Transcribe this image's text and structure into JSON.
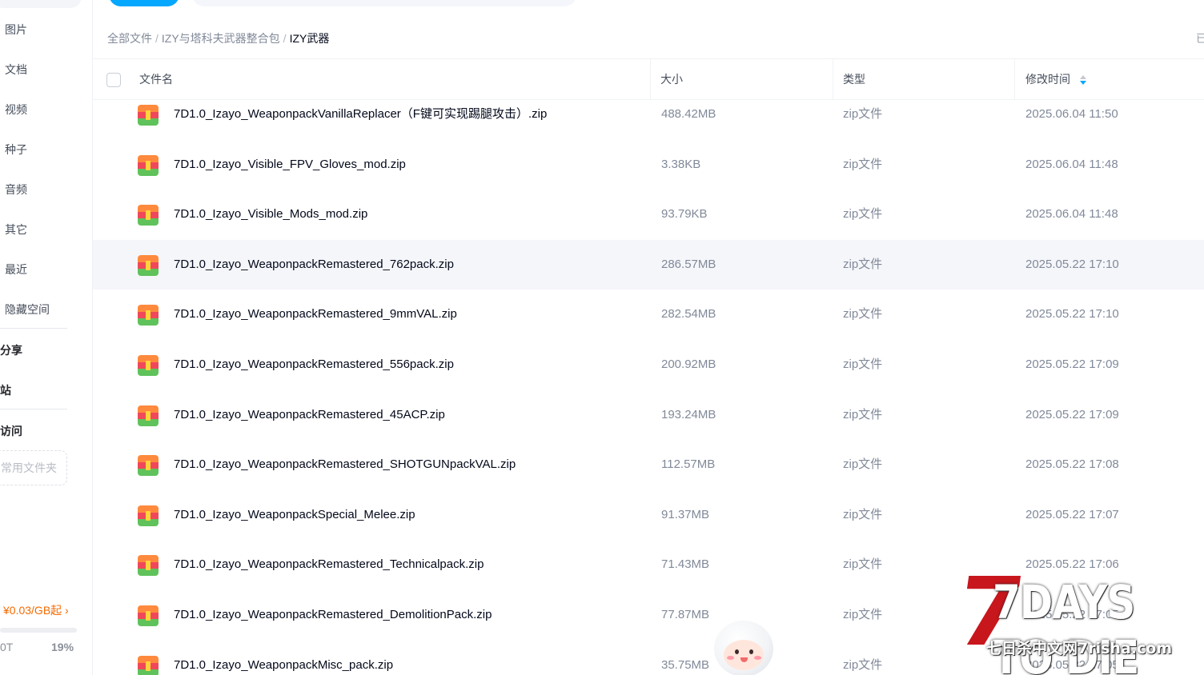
{
  "sidebar": {
    "categories": [
      "图片",
      "文档",
      "视频",
      "种子",
      "音频",
      "其它",
      "最近",
      "隐藏空间"
    ],
    "sections": [
      "分享",
      "站",
      "访问"
    ],
    "quick_folder_placeholder": "常用文件夹",
    "price": "¥0.03/GB起",
    "price_chevron": "›",
    "storage_left": "0T",
    "storage_percent": "19%",
    "storage_percent_value": 0.19
  },
  "breadcrumb": {
    "items": [
      "全部文件",
      "IZY与塔科夫武器整合包"
    ],
    "separator": "/",
    "current": "IZY武器"
  },
  "right_edge_text": "已",
  "table": {
    "headers": {
      "name": "文件名",
      "size": "大小",
      "type": "类型",
      "time": "修改时间"
    },
    "rows": [
      {
        "name": "7D1.0_Izayo_WeaponpackVanillaReplacer（F键可实现踢腿攻击）.zip",
        "size": "488.42MB",
        "type": "zip文件",
        "time": "2025.06.04 11:50"
      },
      {
        "name": "7D1.0_Izayo_Visible_FPV_Gloves_mod.zip",
        "size": "3.38KB",
        "type": "zip文件",
        "time": "2025.06.04 11:48"
      },
      {
        "name": "7D1.0_Izayo_Visible_Mods_mod.zip",
        "size": "93.79KB",
        "type": "zip文件",
        "time": "2025.06.04 11:48"
      },
      {
        "name": "7D1.0_Izayo_WeaponpackRemastered_762pack.zip",
        "size": "286.57MB",
        "type": "zip文件",
        "time": "2025.05.22 17:10"
      },
      {
        "name": "7D1.0_Izayo_WeaponpackRemastered_9mmVAL.zip",
        "size": "282.54MB",
        "type": "zip文件",
        "time": "2025.05.22 17:10"
      },
      {
        "name": "7D1.0_Izayo_WeaponpackRemastered_556pack.zip",
        "size": "200.92MB",
        "type": "zip文件",
        "time": "2025.05.22 17:09"
      },
      {
        "name": "7D1.0_Izayo_WeaponpackRemastered_45ACP.zip",
        "size": "193.24MB",
        "type": "zip文件",
        "time": "2025.05.22 17:09"
      },
      {
        "name": "7D1.0_Izayo_WeaponpackRemastered_SHOTGUNpackVAL.zip",
        "size": "112.57MB",
        "type": "zip文件",
        "time": "2025.05.22 17:08"
      },
      {
        "name": "7D1.0_Izayo_WeaponpackSpecial_Melee.zip",
        "size": "91.37MB",
        "type": "zip文件",
        "time": "2025.05.22 17:07"
      },
      {
        "name": "7D1.0_Izayo_WeaponpackRemastered_Technicalpack.zip",
        "size": "71.43MB",
        "type": "zip文件",
        "time": "2025.05.22 17:06"
      },
      {
        "name": "7D1.0_Izayo_WeaponpackRemastered_DemolitionPack.zip",
        "size": "77.87MB",
        "type": "zip文件",
        "time": "2025.05.22 17:05"
      },
      {
        "name": "7D1.0_Izayo_WeaponpackMisc_pack.zip",
        "size": "35.75MB",
        "type": "zip文件",
        "time": "2025.05.22 17:05"
      }
    ],
    "icon": "zip-file-icon",
    "sort_icon": "sort-desc-icon"
  },
  "watermark": {
    "title": "7DAYS TO DIE",
    "subtitle": "七日杀中文网7risha.com"
  },
  "colors": {
    "accent": "#06a7ff",
    "price": "#f56a00",
    "watermark_red": "#c8161d"
  }
}
